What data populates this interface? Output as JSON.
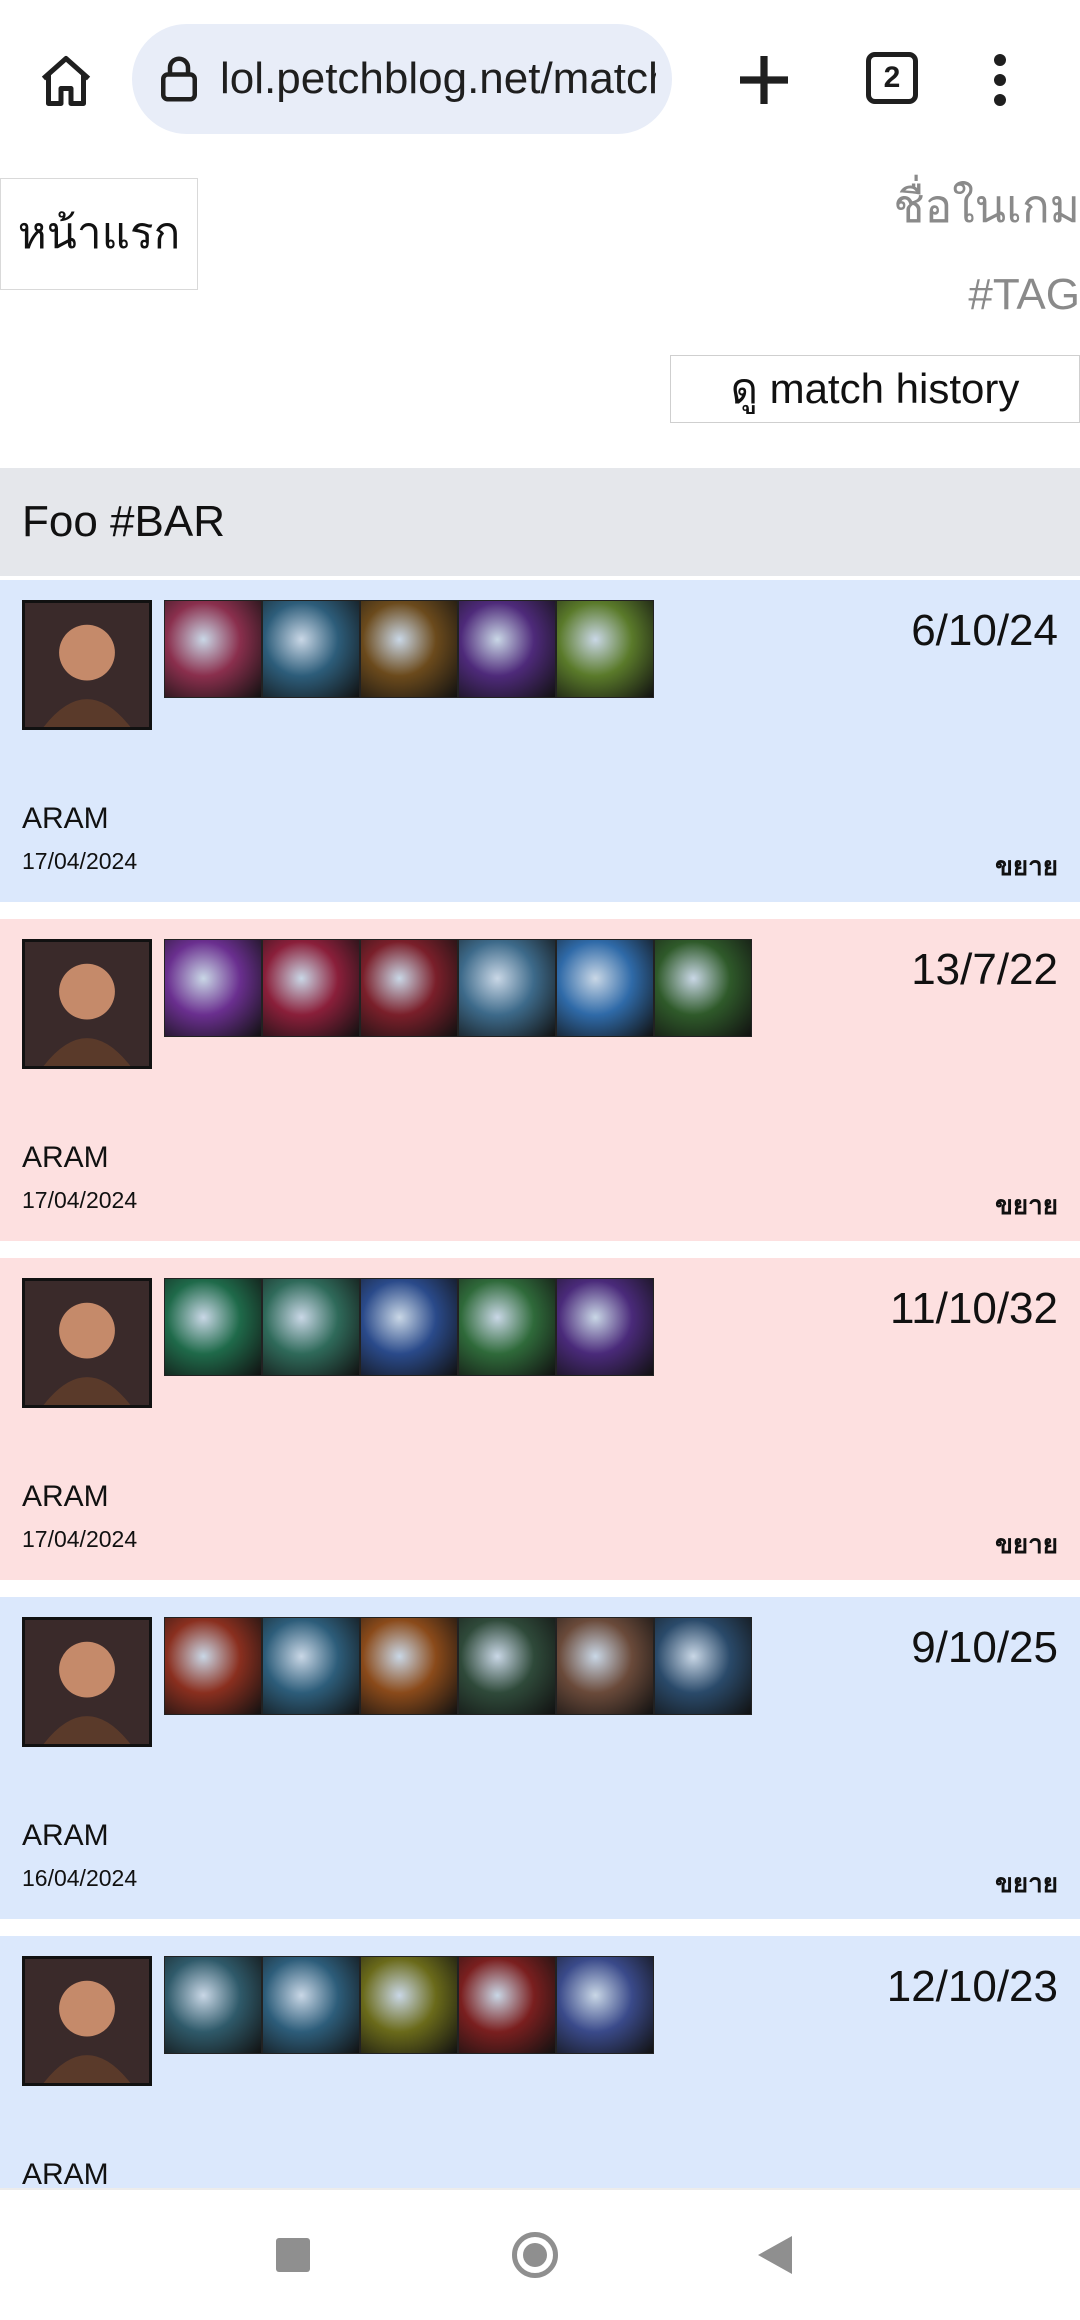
{
  "browser": {
    "url": "lol.petchblog.net/match-history",
    "tab_count": "2"
  },
  "header": {
    "home_label": "หน้าแรก",
    "name_placeholder": "ชื่อในเกม",
    "tag_placeholder": "#TAG",
    "history_button": "ดู match history"
  },
  "player": {
    "name": "Foo #BAR"
  },
  "colors": {
    "win_bg": "#dbe8fc",
    "loss_bg": "#fde0e0",
    "header_bar": "#e5e7eb"
  },
  "matches": [
    {
      "result": "win",
      "champion_icon": "lee-sin-portrait",
      "items": [
        "#8a2f4d",
        "#2d5d7a",
        "#6b4a1c",
        "#4e2a7a",
        "#5a7a2a"
      ],
      "kda": "6/10/24",
      "mode": "ARAM",
      "date": "17/04/2024",
      "expand": "ขยาย"
    },
    {
      "result": "loss",
      "champion_icon": "malzahar-portrait",
      "items": [
        "#6a2f8f",
        "#8a1f3a",
        "#7a1f2a",
        "#3d6a8a",
        "#2f6aa8",
        "#2f5a2a"
      ],
      "kda": "13/7/22",
      "mode": "ARAM",
      "date": "17/04/2024",
      "expand": "ขยาย"
    },
    {
      "result": "loss",
      "champion_icon": "zoe-portrait",
      "items": [
        "#1f6a4a",
        "#2f6a5a",
        "#2a4a8a",
        "#2f6a3a",
        "#4a2a7a"
      ],
      "kda": "11/10/32",
      "mode": "ARAM",
      "date": "17/04/2024",
      "expand": "ขยาย"
    },
    {
      "result": "win",
      "champion_icon": "tahm-kench-portrait",
      "items": [
        "#8a2f1f",
        "#2d5d7a",
        "#8a4a1a",
        "#2f4a3a",
        "#6a4a3a",
        "#2a4a6a"
      ],
      "kda": "9/10/25",
      "mode": "ARAM",
      "date": "16/04/2024",
      "expand": "ขยาย"
    },
    {
      "result": "win",
      "champion_icon": "yasuo-portrait",
      "items": [
        "#2f5a6a",
        "#2d5d7a",
        "#6a6a1a",
        "#7a1f1f",
        "#3a4a8a"
      ],
      "kda": "12/10/23",
      "mode": "ARAM",
      "date": "",
      "expand": ""
    }
  ]
}
